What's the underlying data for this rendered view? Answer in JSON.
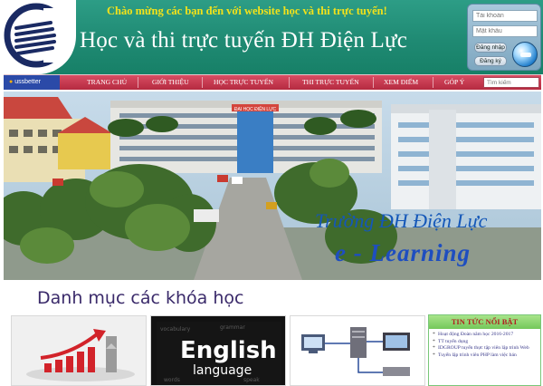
{
  "header": {
    "welcome": "Chào mừng các bạn đến với website học và thi trực tuyến!",
    "title": "Học và thi trực tuyến ĐH Điện Lực"
  },
  "login": {
    "username_placeholder": "Tài khoản",
    "password_placeholder": "Mật khẩu",
    "login_label": "Đăng nhập",
    "register_label": "Đăng ký"
  },
  "nav": {
    "brand": "ussbetter",
    "items": [
      "TRANG CHỦ",
      "GIỚI THIỆU",
      "HỌC TRỰC TUYẾN",
      "THI TRỰC TUYẾN",
      "XEM ĐIỂM",
      "GÓP Ý"
    ],
    "search_placeholder": "Tìm kiếm"
  },
  "banner": {
    "sign": "ĐẠI HỌC ĐIỆN LỰC",
    "line1": "Trường ĐH Điện Lực",
    "line2": "e - Learning"
  },
  "courses": {
    "title": "Danh mục các khóa học",
    "english_words": [
      "English",
      "language"
    ]
  },
  "news": {
    "title": "TIN TỨC NỔI BẬT",
    "items": [
      "Hoạt động Đoàn năm học 2016-2017",
      "TT tuyển dụng",
      "IDGROUP tuyển thực tập viên lập trình Web",
      "Tuyển lập trình viên PHP làm việc bán"
    ]
  },
  "colors": {
    "header_teal": "#1f8a73",
    "welcome_yellow": "#f3e21a",
    "nav_red": "#c23a50",
    "banner_blue": "#1457b8",
    "news_green": "#74c75a"
  }
}
